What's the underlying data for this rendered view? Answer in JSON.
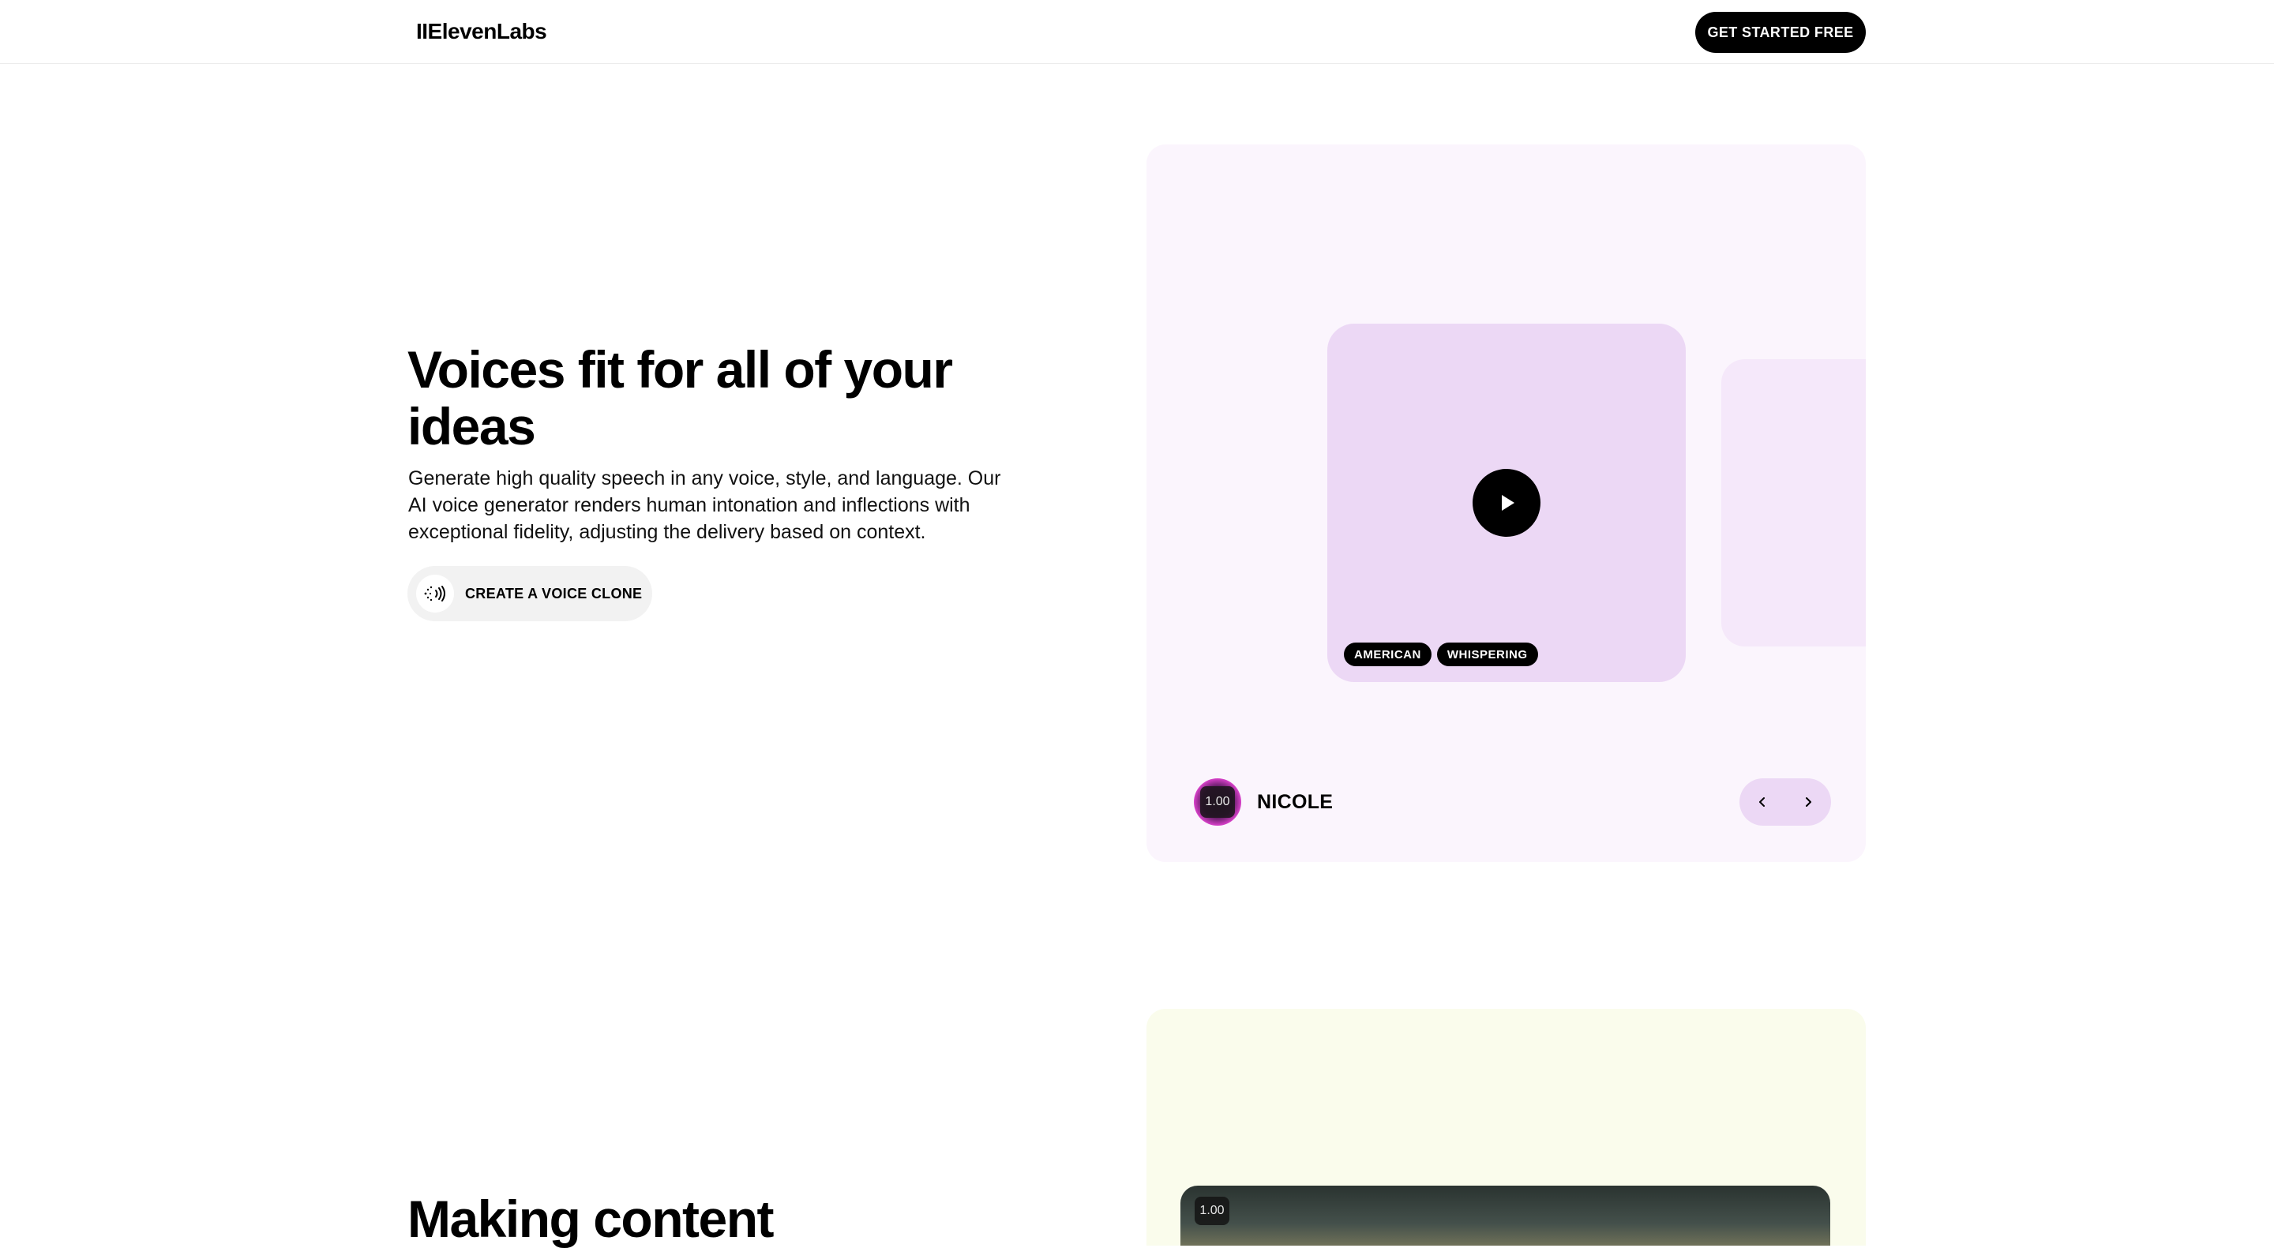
{
  "header": {
    "logo": "IIElevenLabs",
    "cta_label": "GET STARTED FREE"
  },
  "hero": {
    "title": "Voices fit for all of your ideas",
    "description": "Generate high quality speech in any voice, style, and language. Our AI voice generator renders human intonation and inflections with exceptional fidelity, adjusting the delivery based on context.",
    "clone_button_label": "CREATE A VOICE CLONE"
  },
  "voice_card": {
    "tags": [
      "AMERICAN",
      "WHISPERING"
    ],
    "voice_name": "NICOLE",
    "avatar_badge": "1.00",
    "icons": {
      "play": "play-icon",
      "prev": "chevron-left-icon",
      "next": "chevron-right-icon"
    }
  },
  "section2": {
    "title": "Making content",
    "video_badge": "1.00"
  },
  "colors": {
    "voice_card_bg": "#fbf5fd",
    "voice_tile_bg": "#ecd8f5",
    "content_card_bg": "#fafcec",
    "primary": "#000000"
  }
}
